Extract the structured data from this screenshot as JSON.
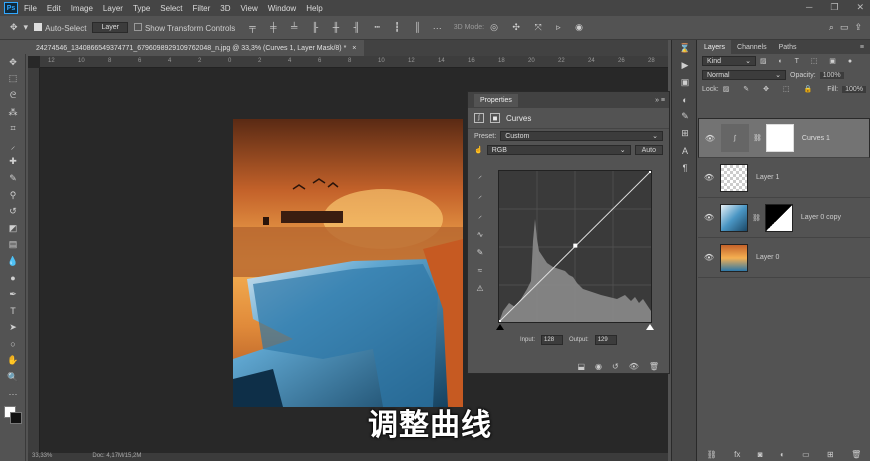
{
  "menubar": {
    "items": [
      "File",
      "Edit",
      "Image",
      "Layer",
      "Type",
      "Select",
      "Filter",
      "3D",
      "View",
      "Window",
      "Help"
    ]
  },
  "options": {
    "auto_select_label": "Auto-Select",
    "auto_select_value": "Layer",
    "transform_label": "Show Transform Controls",
    "mode3d_label": "3D Mode:"
  },
  "document": {
    "tab_title": "24274546_1340866549374771_6796098929109762048_n.jpg @ 33,3% (Curves 1, Layer Mask/8) *",
    "close": "×"
  },
  "rulers": {
    "h": [
      "12",
      "10",
      "8",
      "6",
      "4",
      "2",
      "0",
      "2",
      "4",
      "6",
      "8",
      "10",
      "12",
      "14",
      "16",
      "18",
      "20",
      "22",
      "24",
      "26",
      "28"
    ]
  },
  "status": {
    "zoom": "33,33%",
    "doc": "Doc: 4,17M/15,2M"
  },
  "caption": "调整曲线",
  "properties": {
    "tab": "Properties",
    "title": "Curves",
    "preset_label": "Preset:",
    "preset_value": "Custom",
    "channel": "RGB",
    "auto_label": "Auto",
    "input_label": "Input:",
    "input_value": "128",
    "output_label": "Output:",
    "output_value": "129"
  },
  "curve": {
    "points": [
      [
        0,
        0
      ],
      [
        128,
        129
      ],
      [
        255,
        255
      ]
    ]
  },
  "layers_panel": {
    "tabs": [
      "Layers",
      "Channels",
      "Paths"
    ],
    "kind_label": "Kind",
    "blend_mode": "Normal",
    "opacity_label": "Opacity:",
    "opacity_value": "100%",
    "lock_label": "Lock:",
    "fill_label": "Fill:",
    "fill_value": "100%",
    "layers": [
      {
        "name": "Curves 1",
        "selected": true
      },
      {
        "name": "Layer 1",
        "selected": false
      },
      {
        "name": "Layer 0 copy",
        "selected": false
      },
      {
        "name": "Layer 0",
        "selected": false
      }
    ]
  },
  "colors": {
    "accent": "#31a8ff",
    "panel": "#535353",
    "canvas": "#282828"
  }
}
